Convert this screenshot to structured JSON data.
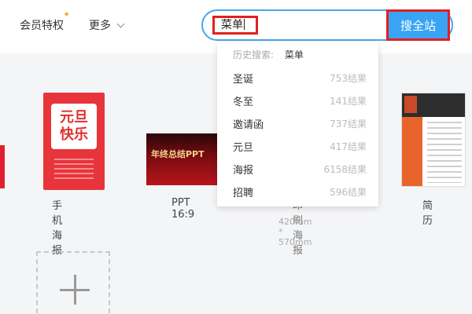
{
  "header": {
    "vip_label": "会员特权",
    "more_label": "更多"
  },
  "search": {
    "value": "菜单",
    "button_label": "搜全站"
  },
  "dropdown": {
    "history_label": "历史搜索:",
    "history_tag": "菜单",
    "suggestions": [
      {
        "name": "圣诞",
        "count": "753结果"
      },
      {
        "name": "冬至",
        "count": "141结果"
      },
      {
        "name": "邀请函",
        "count": "737结果"
      },
      {
        "name": "元旦",
        "count": "417结果"
      },
      {
        "name": "海报",
        "count": "6158结果"
      },
      {
        "name": "招聘",
        "count": "596结果"
      }
    ]
  },
  "cards": [
    {
      "label": "手机海报",
      "thumb_text": [
        "元旦",
        "快乐"
      ]
    },
    {
      "label": "PPT 16:9",
      "thumb_text": "年终总结PPT"
    },
    {
      "label": "印刷海报",
      "size": "420mm * 570mm"
    },
    {
      "label": "简历"
    }
  ],
  "colors": {
    "accent": "#39a4f4",
    "highlight_border": "#e02020"
  }
}
